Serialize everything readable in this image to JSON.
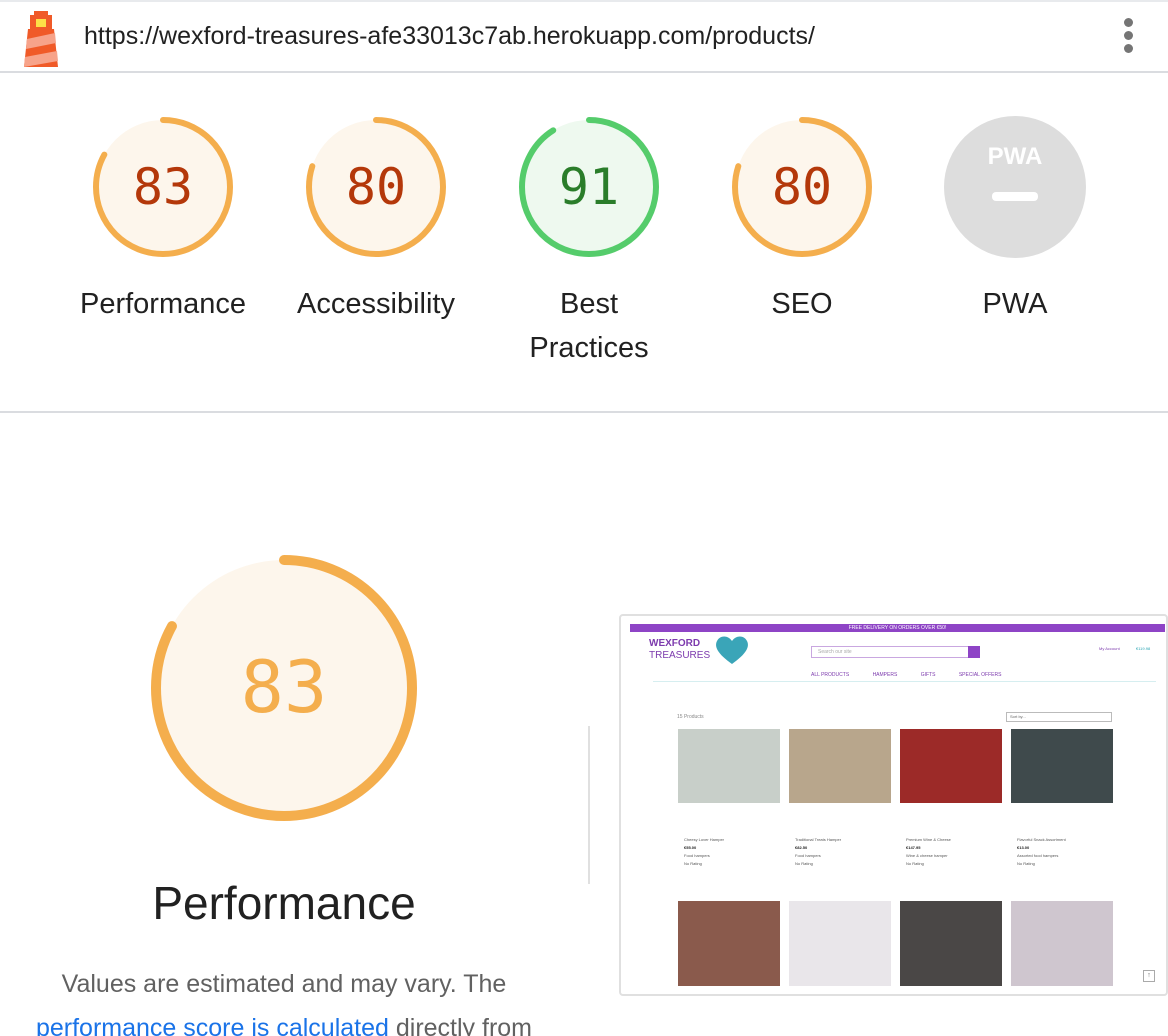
{
  "header": {
    "url": "https://wexford-treasures-afe33013c7ab.herokuapp.com/products/",
    "logo_icon": "lighthouse-icon",
    "menu_icon": "kebab-menu-icon"
  },
  "gauges": [
    {
      "label": "Performance",
      "score": "83",
      "value": 0.83,
      "ring_color": "#f4ae4d",
      "text_color": "#b4380a",
      "fill_color": "#fdf6ec"
    },
    {
      "label": "Accessibility",
      "score": "80",
      "value": 0.8,
      "ring_color": "#f4ae4d",
      "text_color": "#b4380a",
      "fill_color": "#fdf6ec"
    },
    {
      "label": "Best Practices",
      "score": "91",
      "value": 0.91,
      "ring_color": "#55cc6b",
      "text_color": "#2a7d2a",
      "fill_color": "#eef9ef"
    },
    {
      "label": "SEO",
      "score": "80",
      "value": 0.8,
      "ring_color": "#f4ae4d",
      "text_color": "#b4380a",
      "fill_color": "#fdf6ec"
    },
    {
      "label": "PWA",
      "score": "",
      "value": 0,
      "ring_color": "#dddddd",
      "text_color": "#ffffff",
      "fill_color": "#dddddd",
      "badge": "PWA"
    }
  ],
  "performance": {
    "score": "83",
    "value": 0.83,
    "title": "Performance",
    "desc_prefix": "Values are estimated and may vary. The",
    "link_text": "performance score is calculated",
    "desc_suffix": "directly from"
  },
  "screenshot": {
    "banner": "FREE DELIVERY ON ORDERS OVER €50!",
    "brand_line1": "WEXFORD",
    "brand_line2": "TREASURES",
    "search_placeholder": "Search our site",
    "account": "My Account",
    "bag": "€119.98",
    "nav": [
      "ALL PRODUCTS",
      "HAMPERS",
      "GIFTS",
      "SPECIAL OFFERS"
    ],
    "count": "15 Products",
    "sort": "Sort by...",
    "products": [
      {
        "name": "Cheesy Lover Hamper",
        "price": "€55.00",
        "category": "Food hampers",
        "rating": "No Rating",
        "color": "#c8cfc9"
      },
      {
        "name": "Traditional Treats Hamper",
        "price": "€82.50",
        "category": "Food hampers",
        "rating": "No Rating",
        "color": "#b8a68c"
      },
      {
        "name": "Premium Wine & Cheese",
        "price": "€147.95",
        "category": "Wine & cheese hamper",
        "rating": "No Rating",
        "color": "#9c2a28"
      },
      {
        "name": "Flavorful Snack Assortment",
        "price": "€13.00",
        "category": "Assorted food hampers",
        "rating": "No Rating",
        "color": "#3f4a4c"
      }
    ],
    "second_row_colors": [
      "#8a5a4c",
      "#e9e6ea",
      "#4a4746",
      "#cfc6cf"
    ]
  }
}
